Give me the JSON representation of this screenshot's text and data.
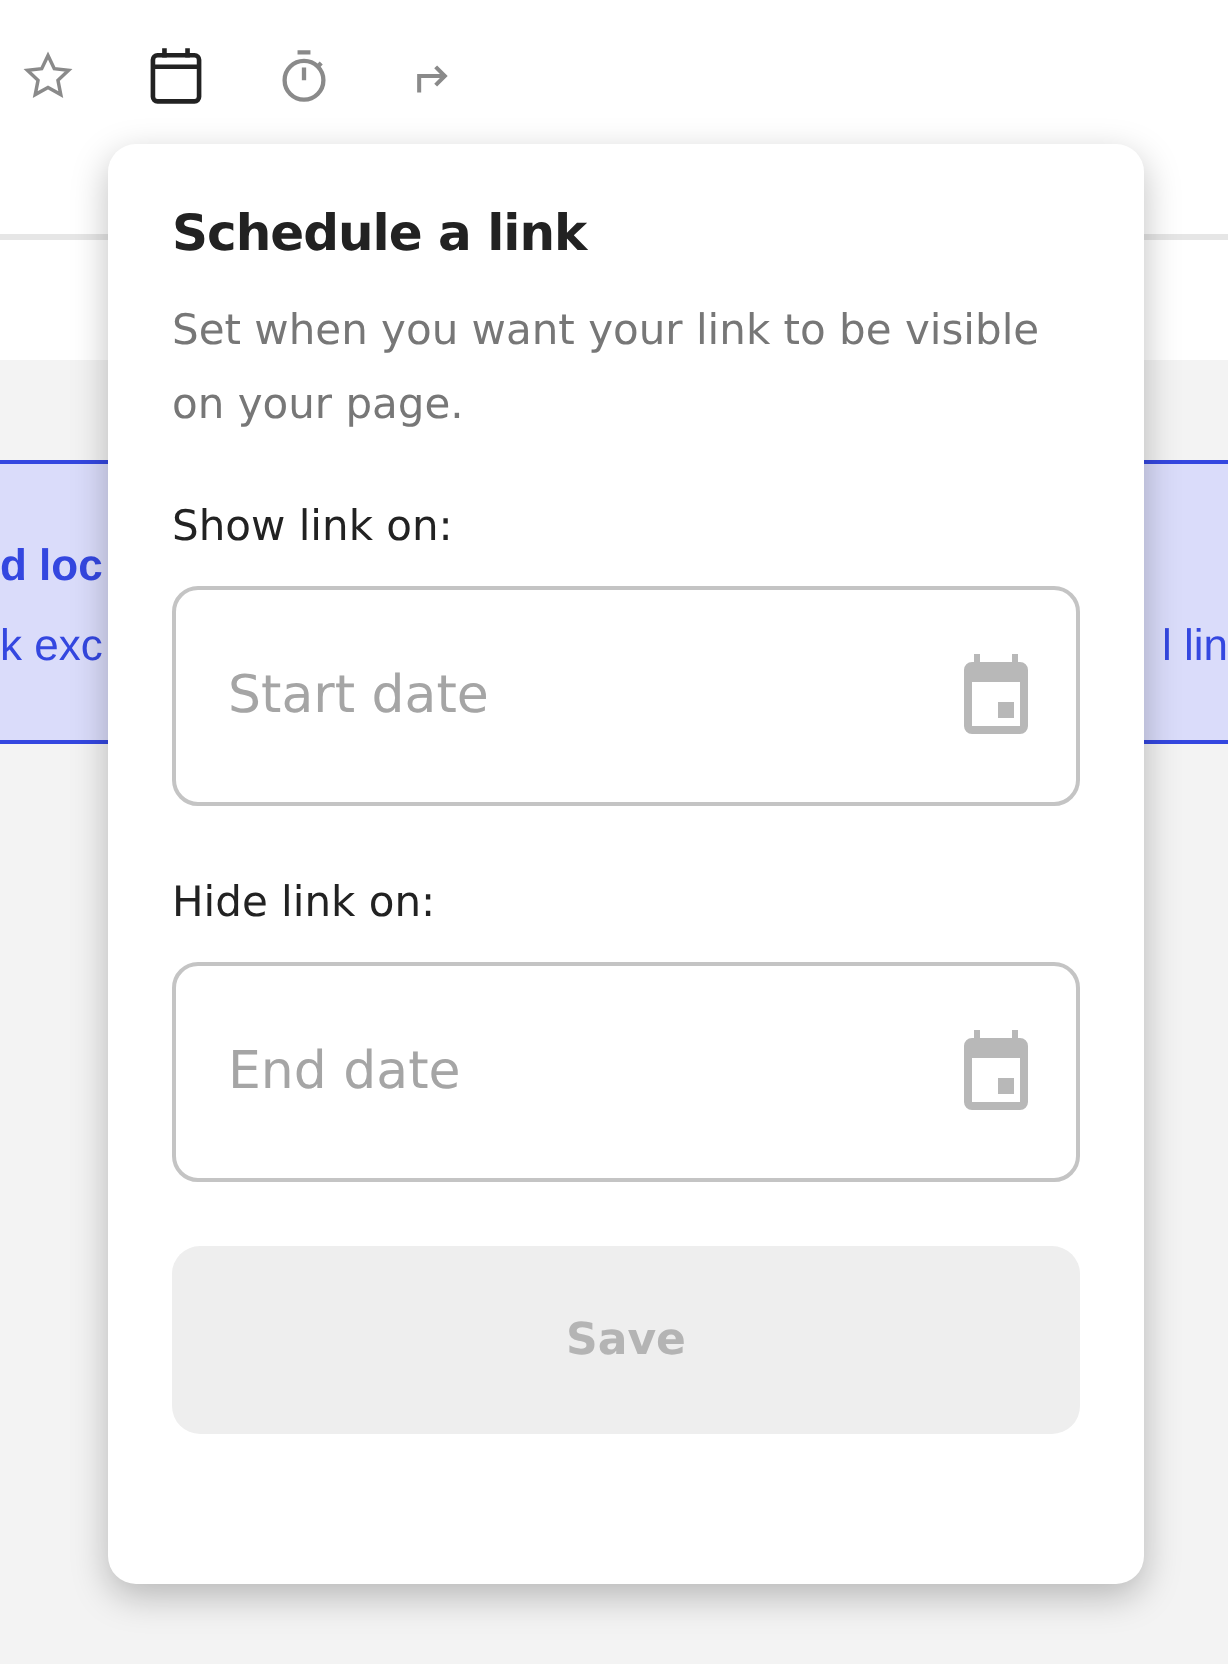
{
  "toolbar": [
    {
      "kind": "star",
      "selected": false
    },
    {
      "kind": "calendar",
      "selected": true
    },
    {
      "kind": "timer",
      "selected": false
    },
    {
      "kind": "forward",
      "selected": false
    }
  ],
  "banner": {
    "left_line_1": "d loc",
    "left_line_2": "k exc",
    "right_line_2": "l lin"
  },
  "popover": {
    "title": "Schedule a link",
    "description": "Set when you want your link to be visible on your page.",
    "fields": [
      {
        "label": "Show link on:",
        "placeholder": "Start date"
      },
      {
        "label": "Hide link on:",
        "placeholder": "End date"
      }
    ],
    "save_button": {
      "label": "Save",
      "disabled": true
    }
  }
}
